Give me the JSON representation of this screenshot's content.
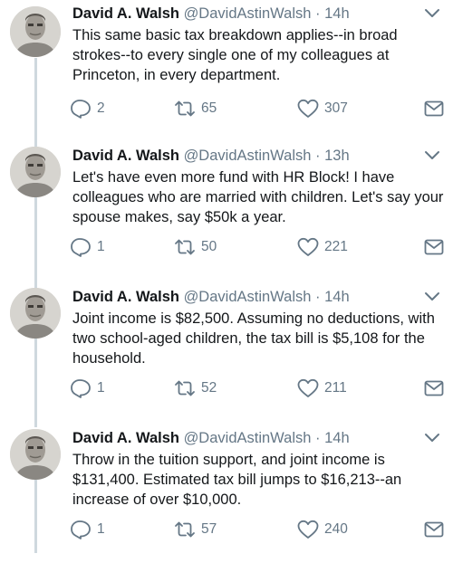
{
  "tweets": [
    {
      "name": "David A. Walsh",
      "handle": "@DavidAstinWalsh",
      "separator": "·",
      "time": "14h",
      "text": "This same basic tax breakdown applies--in broad strokes--to every single one of my colleagues at Princeton, in every department.",
      "replies": "2",
      "retweets": "65",
      "likes": "307"
    },
    {
      "name": "David A. Walsh",
      "handle": "@DavidAstinWalsh",
      "separator": "·",
      "time": "13h",
      "text": "Let's have even more fund with HR Block! I have colleagues who are married with children. Let's say your spouse makes, say $50k a year.",
      "replies": "1",
      "retweets": "50",
      "likes": "221"
    },
    {
      "name": "David A. Walsh",
      "handle": "@DavidAstinWalsh",
      "separator": "·",
      "time": "14h",
      "text": "Joint income is $82,500. Assuming no deductions, with two school-aged children, the tax bill is $5,108 for the household.",
      "replies": "1",
      "retweets": "52",
      "likes": "211"
    },
    {
      "name": "David A. Walsh",
      "handle": "@DavidAstinWalsh",
      "separator": "·",
      "time": "14h",
      "text": "Throw in the tuition support, and joint income is $131,400. Estimated tax bill jumps to $16,213--an increase of over $10,000.",
      "replies": "1",
      "retweets": "57",
      "likes": "240"
    }
  ],
  "icons": {
    "avatar": "avatar",
    "caret": "chevron-down-icon",
    "reply": "reply-icon",
    "retweet": "retweet-icon",
    "like": "heart-icon",
    "message": "direct-message-icon"
  },
  "colors": {
    "text": "#14171a",
    "secondary": "#657786",
    "thread_line": "#cfd8de"
  }
}
